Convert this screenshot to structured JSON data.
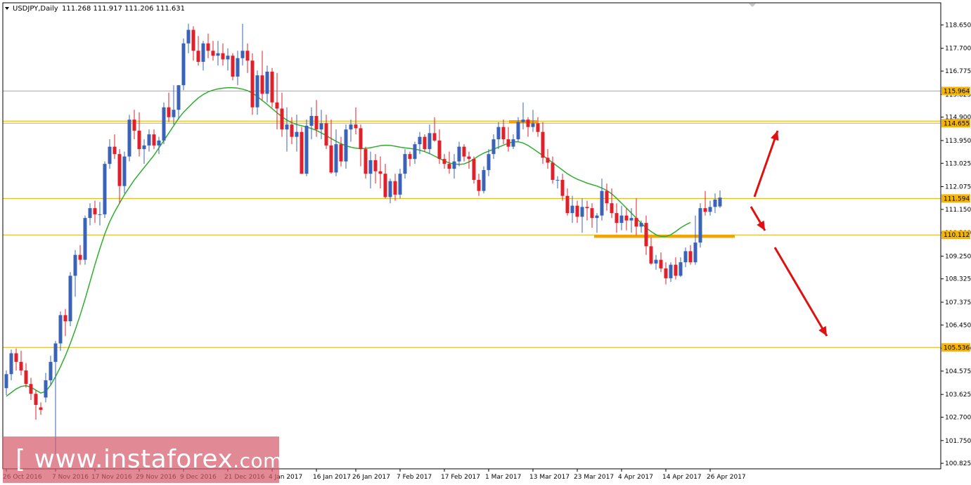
{
  "header": {
    "symbol": "USDJPY,Daily",
    "ohlc": "111.268 111.917 111.206 111.631"
  },
  "watermark": {
    "open_bracket": "[",
    "text": "www.instaforex",
    "suffix": ".com",
    "close_bracket": "]"
  },
  "colors": {
    "bull": "#3a63b8",
    "bear": "#e0202a",
    "ma": "#2fae2f",
    "level": "#e0b000",
    "zone": "#f5a300",
    "arrow": "#e01010",
    "badge": "#f5b400"
  },
  "chart_data": {
    "type": "candlestick",
    "symbol": "USDJPY",
    "timeframe": "Daily",
    "ylim": [
      100.6,
      119.55
    ],
    "y_ticks": [
      "118.650",
      "117.700",
      "116.775",
      "115.825",
      "114.900",
      "113.950",
      "113.025",
      "112.075",
      "111.150",
      "110.200",
      "109.250",
      "108.325",
      "107.375",
      "106.450",
      "105.500",
      "104.575",
      "103.625",
      "102.700",
      "101.750",
      "100.825"
    ],
    "x_ticks": [
      "26 Oct 2016",
      "7 Nov 2016",
      "17 Nov 2016",
      "29 Nov 2016",
      "9 Dec 2016",
      "21 Dec 2016",
      "4 Jan 2017",
      "16 Jan 2017",
      "26 Jan 2017",
      "7 Feb 2017",
      "17 Feb 2017",
      "1 Mar 2017",
      "13 Mar 2017",
      "23 Mar 2017",
      "4 Apr 2017",
      "14 Apr 2017",
      "26 Apr 2017"
    ],
    "x_tick_index": [
      0,
      10,
      18,
      27,
      36,
      45,
      54,
      63,
      71,
      80,
      89,
      98,
      107,
      116,
      125,
      134,
      143
    ],
    "levels": [
      "115.964",
      "114.655",
      "111.594",
      "110.112",
      "105.536"
    ],
    "ma_line": [
      103.55,
      103.7,
      103.85,
      103.95,
      103.98,
      103.92,
      103.8,
      103.68,
      103.75,
      104.0,
      104.35,
      104.75,
      105.2,
      105.7,
      106.25,
      106.85,
      107.5,
      108.2,
      108.9,
      109.55,
      110.15,
      110.65,
      111.05,
      111.4,
      111.75,
      112.05,
      112.35,
      112.6,
      112.85,
      113.1,
      113.35,
      113.65,
      113.95,
      114.25,
      114.55,
      114.85,
      115.1,
      115.3,
      115.5,
      115.68,
      115.82,
      115.93,
      116.0,
      116.05,
      116.08,
      116.1,
      116.1,
      116.08,
      116.04,
      115.98,
      115.88,
      115.74,
      115.58,
      115.42,
      115.25,
      115.08,
      114.92,
      114.78,
      114.68,
      114.6,
      114.55,
      114.5,
      114.44,
      114.36,
      114.26,
      114.15,
      114.03,
      113.92,
      113.82,
      113.74,
      113.68,
      113.64,
      113.62,
      113.63,
      113.66,
      113.7,
      113.74,
      113.76,
      113.75,
      113.72,
      113.68,
      113.65,
      113.63,
      113.6,
      113.56,
      113.5,
      113.42,
      113.32,
      113.22,
      113.12,
      113.04,
      113.0,
      112.98,
      113.0,
      113.08,
      113.2,
      113.33,
      113.44,
      113.52,
      113.6,
      113.68,
      113.76,
      113.84,
      113.9,
      113.9,
      113.85,
      113.75,
      113.62,
      113.48,
      113.34,
      113.2,
      113.05,
      112.9,
      112.75,
      112.6,
      112.48,
      112.38,
      112.3,
      112.22,
      112.16,
      112.1,
      112.02,
      111.92,
      111.78,
      111.6,
      111.4,
      111.2,
      111.0,
      110.8,
      110.58,
      110.4,
      110.25,
      110.12,
      110.05,
      110.05,
      110.12,
      110.25,
      110.4,
      110.52,
      110.62
    ],
    "candles": [
      [
        103.88,
        104.6,
        103.6,
        104.45
      ],
      [
        104.45,
        105.45,
        104.2,
        105.3
      ],
      [
        105.3,
        105.5,
        104.6,
        104.95
      ],
      [
        104.95,
        105.4,
        104.4,
        104.6
      ],
      [
        104.6,
        104.9,
        103.9,
        104.05
      ],
      [
        104.05,
        104.3,
        103.4,
        103.65
      ],
      [
        103.65,
        103.8,
        102.6,
        103.2
      ],
      [
        103.1,
        103.3,
        102.8,
        103.0
      ],
      [
        103.5,
        104.5,
        103.3,
        104.2
      ],
      [
        104.2,
        105.2,
        104.0,
        104.95
      ],
      [
        104.95,
        105.8,
        101.2,
        105.7
      ],
      [
        105.7,
        107.0,
        105.4,
        106.85
      ],
      [
        106.85,
        107.1,
        106.0,
        106.6
      ],
      [
        106.6,
        108.6,
        106.4,
        108.45
      ],
      [
        108.45,
        109.5,
        107.6,
        109.3
      ],
      [
        109.3,
        109.7,
        108.9,
        109.1
      ],
      [
        109.1,
        110.9,
        108.9,
        110.8
      ],
      [
        110.8,
        111.4,
        110.5,
        111.2
      ],
      [
        111.2,
        111.5,
        110.6,
        110.95
      ],
      [
        110.95,
        111.45,
        110.5,
        110.95
      ],
      [
        110.95,
        113.1,
        110.8,
        113.0
      ],
      [
        113.0,
        114.0,
        112.8,
        113.7
      ],
      [
        113.7,
        114.2,
        113.2,
        113.4
      ],
      [
        113.4,
        113.6,
        111.4,
        112.1
      ],
      [
        112.1,
        113.5,
        111.8,
        113.3
      ],
      [
        113.3,
        115.0,
        113.1,
        114.8
      ],
      [
        114.8,
        115.2,
        114.0,
        114.35
      ],
      [
        114.35,
        115.1,
        113.3,
        113.6
      ],
      [
        113.6,
        114.0,
        113.0,
        113.75
      ],
      [
        113.75,
        114.4,
        113.5,
        114.2
      ],
      [
        114.2,
        114.4,
        113.6,
        113.75
      ],
      [
        113.75,
        114.1,
        113.4,
        113.95
      ],
      [
        113.95,
        115.5,
        113.8,
        115.3
      ],
      [
        115.3,
        115.9,
        114.7,
        114.9
      ],
      [
        114.9,
        116.2,
        114.6,
        115.2
      ],
      [
        115.2,
        116.2,
        114.8,
        116.2
      ],
      [
        116.2,
        118.1,
        116.0,
        117.9
      ],
      [
        117.9,
        118.7,
        117.5,
        118.45
      ],
      [
        118.45,
        118.6,
        117.2,
        117.6
      ],
      [
        117.6,
        118.2,
        117.0,
        117.15
      ],
      [
        117.15,
        118.0,
        116.8,
        117.9
      ],
      [
        117.9,
        118.3,
        117.3,
        117.6
      ],
      [
        117.6,
        118.0,
        117.2,
        117.4
      ],
      [
        117.4,
        118.0,
        117.0,
        117.5
      ],
      [
        117.5,
        117.9,
        117.0,
        117.25
      ],
      [
        117.25,
        117.7,
        116.8,
        117.4
      ],
      [
        117.4,
        117.5,
        116.4,
        116.55
      ],
      [
        116.55,
        117.6,
        116.2,
        117.3
      ],
      [
        117.3,
        118.7,
        117.0,
        117.6
      ],
      [
        117.6,
        117.9,
        116.7,
        117.2
      ],
      [
        117.2,
        117.5,
        115.0,
        115.3
      ],
      [
        115.3,
        116.8,
        115.0,
        116.6
      ],
      [
        116.6,
        117.6,
        115.6,
        115.85
      ],
      [
        115.85,
        117.0,
        115.5,
        116.75
      ],
      [
        116.75,
        116.9,
        115.3,
        115.5
      ],
      [
        115.5,
        116.7,
        114.4,
        115.25
      ],
      [
        115.25,
        115.9,
        114.1,
        114.4
      ],
      [
        114.4,
        115.3,
        113.5,
        114.6
      ],
      [
        114.6,
        114.9,
        113.8,
        114.1
      ],
      [
        114.1,
        115.0,
        113.5,
        114.3
      ],
      [
        114.3,
        114.5,
        112.6,
        112.6
      ],
      [
        112.6,
        114.8,
        112.5,
        114.55
      ],
      [
        114.55,
        115.3,
        114.0,
        114.95
      ],
      [
        114.95,
        115.6,
        114.1,
        114.4
      ],
      [
        114.4,
        115.2,
        114.0,
        114.65
      ],
      [
        114.65,
        115.0,
        113.6,
        113.75
      ],
      [
        113.75,
        114.8,
        112.6,
        112.65
      ],
      [
        112.65,
        114.4,
        112.5,
        113.8
      ],
      [
        113.8,
        114.1,
        112.9,
        113.1
      ],
      [
        113.1,
        114.6,
        112.8,
        114.4
      ],
      [
        114.4,
        114.8,
        113.9,
        114.6
      ],
      [
        114.6,
        115.3,
        114.2,
        114.45
      ],
      [
        114.45,
        114.6,
        112.9,
        113.6
      ],
      [
        113.6,
        113.7,
        112.4,
        112.6
      ],
      [
        112.6,
        113.5,
        112.0,
        113.15
      ],
      [
        113.15,
        113.4,
        112.2,
        112.7
      ],
      [
        112.7,
        113.3,
        112.0,
        112.6
      ],
      [
        112.6,
        113.0,
        111.6,
        111.65
      ],
      [
        111.65,
        112.4,
        111.4,
        112.3
      ],
      [
        112.3,
        112.6,
        111.5,
        111.75
      ],
      [
        111.75,
        112.8,
        111.6,
        112.6
      ],
      [
        112.6,
        113.6,
        112.4,
        113.4
      ],
      [
        113.4,
        113.5,
        112.9,
        113.2
      ],
      [
        113.2,
        113.9,
        113.0,
        113.8
      ],
      [
        113.8,
        114.3,
        113.4,
        114.1
      ],
      [
        114.1,
        114.2,
        113.5,
        113.6
      ],
      [
        113.6,
        114.6,
        113.4,
        114.25
      ],
      [
        114.25,
        114.9,
        113.9,
        113.95
      ],
      [
        113.95,
        114.4,
        113.0,
        113.2
      ],
      [
        113.2,
        113.4,
        112.8,
        113.0
      ],
      [
        113.0,
        113.5,
        112.6,
        112.8
      ],
      [
        112.8,
        113.4,
        112.4,
        113.1
      ],
      [
        113.1,
        113.9,
        112.9,
        113.7
      ],
      [
        113.7,
        113.8,
        113.1,
        113.3
      ],
      [
        113.3,
        113.5,
        112.8,
        113.2
      ],
      [
        113.2,
        113.3,
        112.2,
        112.35
      ],
      [
        112.35,
        112.6,
        111.7,
        111.9
      ],
      [
        111.9,
        112.9,
        111.8,
        112.75
      ],
      [
        112.75,
        113.6,
        112.5,
        113.4
      ],
      [
        113.4,
        114.2,
        113.2,
        114.0
      ],
      [
        114.0,
        114.7,
        113.6,
        114.5
      ],
      [
        114.5,
        114.8,
        113.8,
        114.0
      ],
      [
        114.0,
        114.5,
        113.5,
        113.7
      ],
      [
        113.7,
        114.2,
        113.6,
        114.0
      ],
      [
        114.0,
        114.9,
        113.9,
        114.7
      ],
      [
        114.7,
        115.5,
        114.4,
        114.8
      ],
      [
        114.8,
        114.9,
        114.1,
        114.5
      ],
      [
        114.5,
        115.2,
        114.3,
        114.65
      ],
      [
        114.65,
        114.9,
        114.1,
        114.3
      ],
      [
        114.3,
        114.7,
        113.0,
        113.25
      ],
      [
        113.25,
        113.6,
        112.8,
        113.05
      ],
      [
        113.05,
        113.3,
        112.2,
        112.35
      ],
      [
        112.35,
        112.5,
        112.0,
        112.35
      ],
      [
        112.35,
        112.6,
        111.5,
        111.7
      ],
      [
        111.7,
        112.0,
        110.9,
        111.0
      ],
      [
        111.0,
        111.7,
        110.6,
        111.3
      ],
      [
        111.3,
        111.5,
        110.6,
        110.85
      ],
      [
        110.85,
        111.6,
        110.2,
        111.25
      ],
      [
        111.25,
        111.5,
        110.7,
        111.2
      ],
      [
        111.2,
        111.4,
        110.4,
        110.8
      ],
      [
        110.8,
        111.0,
        110.2,
        110.9
      ],
      [
        110.9,
        112.4,
        110.7,
        111.9
      ],
      [
        111.9,
        112.2,
        111.1,
        111.4
      ],
      [
        111.4,
        112.0,
        110.8,
        111.0
      ],
      [
        111.0,
        111.4,
        110.2,
        110.6
      ],
      [
        110.6,
        111.3,
        110.3,
        110.9
      ],
      [
        110.9,
        111.2,
        110.3,
        110.7
      ],
      [
        110.7,
        111.2,
        110.2,
        110.8
      ],
      [
        110.8,
        111.6,
        110.1,
        110.45
      ],
      [
        110.45,
        110.7,
        110.2,
        110.6
      ],
      [
        110.6,
        110.9,
        109.3,
        109.65
      ],
      [
        109.65,
        110.0,
        108.9,
        108.95
      ],
      [
        108.95,
        109.3,
        108.7,
        109.1
      ],
      [
        109.1,
        109.4,
        108.6,
        108.75
      ],
      [
        108.75,
        109.0,
        108.1,
        108.35
      ],
      [
        108.35,
        109.0,
        108.2,
        108.9
      ],
      [
        108.9,
        109.2,
        108.3,
        108.45
      ],
      [
        108.45,
        109.2,
        108.4,
        109.0
      ],
      [
        109.0,
        109.6,
        108.8,
        109.45
      ],
      [
        109.45,
        109.7,
        108.9,
        109.0
      ],
      [
        109.0,
        110.9,
        108.9,
        109.8
      ],
      [
        109.8,
        111.4,
        109.6,
        111.2
      ],
      [
        111.2,
        111.9,
        110.9,
        111.05
      ],
      [
        111.05,
        111.5,
        110.9,
        111.25
      ],
      [
        111.25,
        111.8,
        111.0,
        111.55
      ],
      [
        111.27,
        111.92,
        111.21,
        111.63
      ]
    ]
  }
}
